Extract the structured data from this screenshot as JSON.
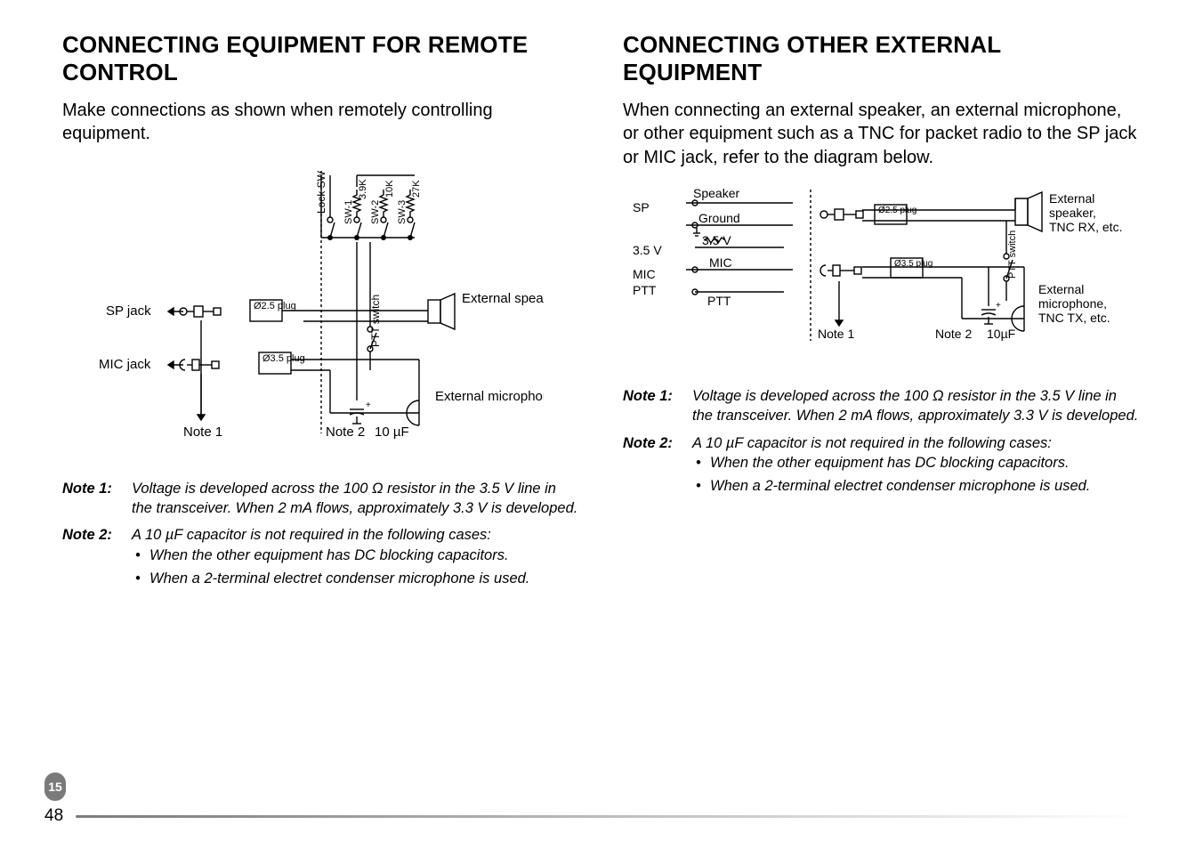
{
  "left": {
    "title": "CONNECTING EQUIPMENT FOR REMOTE CONTROL",
    "intro": "Make connections as shown when remotely controlling equipment.",
    "diagram": {
      "sp_jack": "SP jack",
      "mic_jack": "MIC jack",
      "plug25": "Ø2.5 plug",
      "plug35": "Ø3.5 plug",
      "note1": "Note 1",
      "note2": "Note 2",
      "cap": "10 µF",
      "ext_spk": "External speaker",
      "ext_mic": "External microphone",
      "ptt": "PTT switch",
      "lock": "Lock SW",
      "sw1": "SW-1",
      "r1": "3.9K",
      "sw2": "SW-2",
      "r2": "10K",
      "sw3": "SW-3",
      "r3": "27K"
    },
    "notes": [
      {
        "label": "Note 1:",
        "body": "Voltage is developed across the 100 Ω resistor in the 3.5 V line in the transceiver.  When 2 mA flows, approximately 3.3 V is developed."
      },
      {
        "label": "Note 2:",
        "body": "A 10 µF capacitor is not required in the following cases:",
        "sub": [
          "When the other equipment has DC blocking capacitors.",
          "When a 2-terminal electret condenser microphone is used."
        ]
      }
    ]
  },
  "right": {
    "title": "CONNECTING OTHER EXTERNAL EQUIPMENT",
    "intro": "When connecting an external speaker, an external microphone, or other equipment such as a TNC for packet radio to the SP jack or MIC jack, refer to the diagram below.",
    "diagram": {
      "sp": "SP",
      "speaker": "Speaker",
      "ground": "Ground",
      "v35": "3.5 V",
      "mic_lbl": "MIC",
      "mic": "MIC",
      "ptt_lbl": "PTT",
      "ptt": "PTT",
      "plug25": "Ø2.5 plug",
      "plug35": "Ø3.5 plug",
      "ext_spk": "External speaker, TNC RX, etc.",
      "ext_mic": "External microphone, TNC TX, etc.",
      "ptt_sw": "PTT switch",
      "note1": "Note 1",
      "note2": "Note 2",
      "cap": "10µF"
    },
    "notes": [
      {
        "label": "Note 1:",
        "body": "Voltage is developed across the 100 Ω resistor in the 3.5 V line in the transceiver.  When 2 mA flows, approximately 3.3 V is developed."
      },
      {
        "label": "Note 2:",
        "body": "A 10 µF capacitor is not required in the following cases:",
        "sub": [
          "When the other equipment has DC blocking capacitors.",
          "When a 2-terminal electret condenser microphone is used."
        ]
      }
    ]
  },
  "footer": {
    "chapter": "15",
    "page": "48"
  }
}
